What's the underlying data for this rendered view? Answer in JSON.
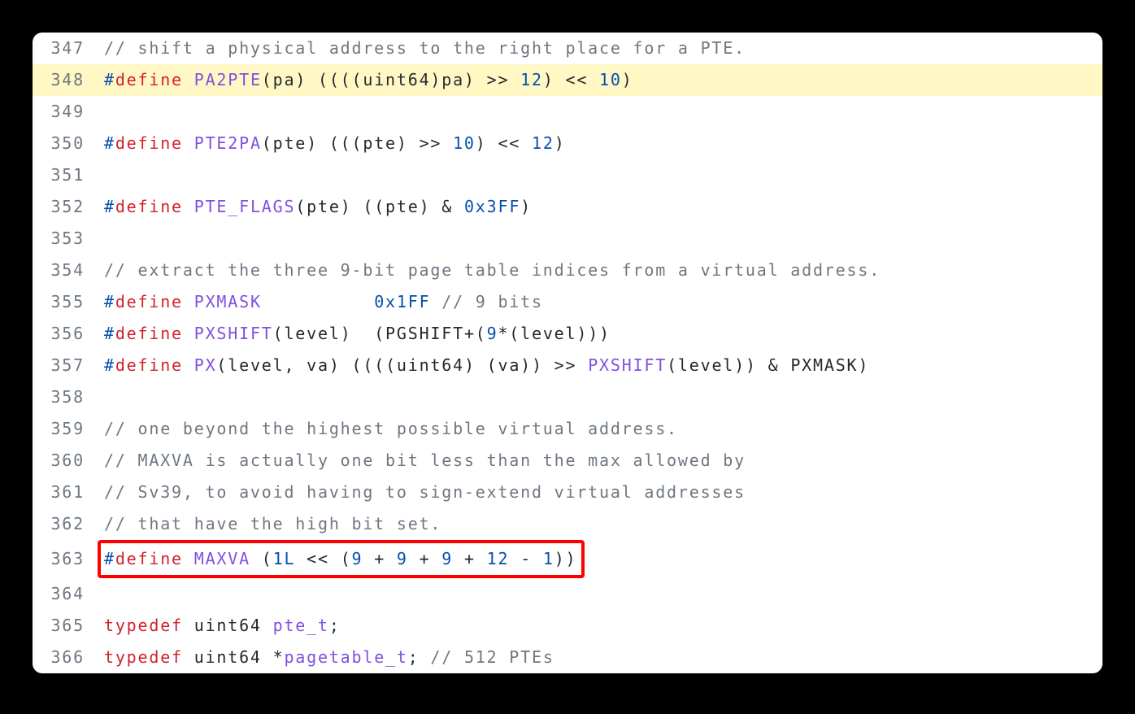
{
  "lines": [
    {
      "no": "347",
      "hl": false,
      "box": false,
      "tokens": [
        {
          "cls": "c-comment",
          "t": "// shift a physical address to the right place for a PTE."
        }
      ]
    },
    {
      "no": "348",
      "hl": true,
      "box": false,
      "tokens": [
        {
          "cls": "c-hash",
          "t": "#"
        },
        {
          "cls": "c-keyword",
          "t": "define"
        },
        {
          "cls": "c-plain",
          "t": " "
        },
        {
          "cls": "c-macro",
          "t": "PA2PTE"
        },
        {
          "cls": "c-plain",
          "t": "("
        },
        {
          "cls": "c-param",
          "t": "pa"
        },
        {
          "cls": "c-plain",
          "t": ") ((((uint64)pa) >> "
        },
        {
          "cls": "c-num",
          "t": "12"
        },
        {
          "cls": "c-plain",
          "t": ") << "
        },
        {
          "cls": "c-num",
          "t": "10"
        },
        {
          "cls": "c-plain",
          "t": ")"
        }
      ]
    },
    {
      "no": "349",
      "hl": false,
      "box": false,
      "tokens": []
    },
    {
      "no": "350",
      "hl": false,
      "box": false,
      "tokens": [
        {
          "cls": "c-hash",
          "t": "#"
        },
        {
          "cls": "c-keyword",
          "t": "define"
        },
        {
          "cls": "c-plain",
          "t": " "
        },
        {
          "cls": "c-macro",
          "t": "PTE2PA"
        },
        {
          "cls": "c-plain",
          "t": "("
        },
        {
          "cls": "c-param",
          "t": "pte"
        },
        {
          "cls": "c-plain",
          "t": ") (((pte) >> "
        },
        {
          "cls": "c-num",
          "t": "10"
        },
        {
          "cls": "c-plain",
          "t": ") << "
        },
        {
          "cls": "c-num",
          "t": "12"
        },
        {
          "cls": "c-plain",
          "t": ")"
        }
      ]
    },
    {
      "no": "351",
      "hl": false,
      "box": false,
      "tokens": []
    },
    {
      "no": "352",
      "hl": false,
      "box": false,
      "tokens": [
        {
          "cls": "c-hash",
          "t": "#"
        },
        {
          "cls": "c-keyword",
          "t": "define"
        },
        {
          "cls": "c-plain",
          "t": " "
        },
        {
          "cls": "c-macro",
          "t": "PTE_FLAGS"
        },
        {
          "cls": "c-plain",
          "t": "("
        },
        {
          "cls": "c-param",
          "t": "pte"
        },
        {
          "cls": "c-plain",
          "t": ") ((pte) & "
        },
        {
          "cls": "c-num",
          "t": "0x3FF"
        },
        {
          "cls": "c-plain",
          "t": ")"
        }
      ]
    },
    {
      "no": "353",
      "hl": false,
      "box": false,
      "tokens": []
    },
    {
      "no": "354",
      "hl": false,
      "box": false,
      "tokens": [
        {
          "cls": "c-comment",
          "t": "// extract the three 9-bit page table indices from a virtual address."
        }
      ]
    },
    {
      "no": "355",
      "hl": false,
      "box": false,
      "tokens": [
        {
          "cls": "c-hash",
          "t": "#"
        },
        {
          "cls": "c-keyword",
          "t": "define"
        },
        {
          "cls": "c-plain",
          "t": " "
        },
        {
          "cls": "c-macro",
          "t": "PXMASK"
        },
        {
          "cls": "c-plain",
          "t": "          "
        },
        {
          "cls": "c-num",
          "t": "0x1FF"
        },
        {
          "cls": "c-plain",
          "t": " "
        },
        {
          "cls": "c-comment",
          "t": "// 9 bits"
        }
      ]
    },
    {
      "no": "356",
      "hl": false,
      "box": false,
      "tokens": [
        {
          "cls": "c-hash",
          "t": "#"
        },
        {
          "cls": "c-keyword",
          "t": "define"
        },
        {
          "cls": "c-plain",
          "t": " "
        },
        {
          "cls": "c-macro",
          "t": "PXSHIFT"
        },
        {
          "cls": "c-plain",
          "t": "("
        },
        {
          "cls": "c-param",
          "t": "level"
        },
        {
          "cls": "c-plain",
          "t": ")  (PGSHIFT+("
        },
        {
          "cls": "c-num",
          "t": "9"
        },
        {
          "cls": "c-plain",
          "t": "*(level)))"
        }
      ]
    },
    {
      "no": "357",
      "hl": false,
      "box": false,
      "tokens": [
        {
          "cls": "c-hash",
          "t": "#"
        },
        {
          "cls": "c-keyword",
          "t": "define"
        },
        {
          "cls": "c-plain",
          "t": " "
        },
        {
          "cls": "c-macro",
          "t": "PX"
        },
        {
          "cls": "c-plain",
          "t": "("
        },
        {
          "cls": "c-param",
          "t": "level"
        },
        {
          "cls": "c-plain",
          "t": ", "
        },
        {
          "cls": "c-param",
          "t": "va"
        },
        {
          "cls": "c-plain",
          "t": ") ((((uint64) (va)) >> "
        },
        {
          "cls": "c-macro",
          "t": "PXSHIFT"
        },
        {
          "cls": "c-plain",
          "t": "(level)) & PXMASK)"
        }
      ]
    },
    {
      "no": "358",
      "hl": false,
      "box": false,
      "tokens": []
    },
    {
      "no": "359",
      "hl": false,
      "box": false,
      "tokens": [
        {
          "cls": "c-comment",
          "t": "// one beyond the highest possible virtual address."
        }
      ]
    },
    {
      "no": "360",
      "hl": false,
      "box": false,
      "tokens": [
        {
          "cls": "c-comment",
          "t": "// MAXVA is actually one bit less than the max allowed by"
        }
      ]
    },
    {
      "no": "361",
      "hl": false,
      "box": false,
      "tokens": [
        {
          "cls": "c-comment",
          "t": "// Sv39, to avoid having to sign-extend virtual addresses"
        }
      ]
    },
    {
      "no": "362",
      "hl": false,
      "box": false,
      "tokens": [
        {
          "cls": "c-comment",
          "t": "// that have the high bit set."
        }
      ]
    },
    {
      "no": "363",
      "hl": false,
      "box": true,
      "tokens": [
        {
          "cls": "c-hash",
          "t": "#"
        },
        {
          "cls": "c-keyword",
          "t": "define"
        },
        {
          "cls": "c-plain",
          "t": " "
        },
        {
          "cls": "c-macro",
          "t": "MAXVA"
        },
        {
          "cls": "c-plain",
          "t": " ("
        },
        {
          "cls": "c-num",
          "t": "1L"
        },
        {
          "cls": "c-plain",
          "t": " << ("
        },
        {
          "cls": "c-num",
          "t": "9"
        },
        {
          "cls": "c-plain",
          "t": " + "
        },
        {
          "cls": "c-num",
          "t": "9"
        },
        {
          "cls": "c-plain",
          "t": " + "
        },
        {
          "cls": "c-num",
          "t": "9"
        },
        {
          "cls": "c-plain",
          "t": " + "
        },
        {
          "cls": "c-num",
          "t": "12"
        },
        {
          "cls": "c-plain",
          "t": " - "
        },
        {
          "cls": "c-num",
          "t": "1"
        },
        {
          "cls": "c-plain",
          "t": "))"
        }
      ]
    },
    {
      "no": "364",
      "hl": false,
      "box": false,
      "tokens": []
    },
    {
      "no": "365",
      "hl": false,
      "box": false,
      "tokens": [
        {
          "cls": "c-keyword",
          "t": "typedef"
        },
        {
          "cls": "c-plain",
          "t": " uint64 "
        },
        {
          "cls": "c-macro",
          "t": "pte_t"
        },
        {
          "cls": "c-plain",
          "t": ";"
        }
      ]
    },
    {
      "no": "366",
      "hl": false,
      "box": false,
      "tokens": [
        {
          "cls": "c-keyword",
          "t": "typedef"
        },
        {
          "cls": "c-plain",
          "t": " uint64 *"
        },
        {
          "cls": "c-macro",
          "t": "pagetable_t"
        },
        {
          "cls": "c-plain",
          "t": "; "
        },
        {
          "cls": "c-comment",
          "t": "// 512 PTEs"
        }
      ]
    }
  ]
}
